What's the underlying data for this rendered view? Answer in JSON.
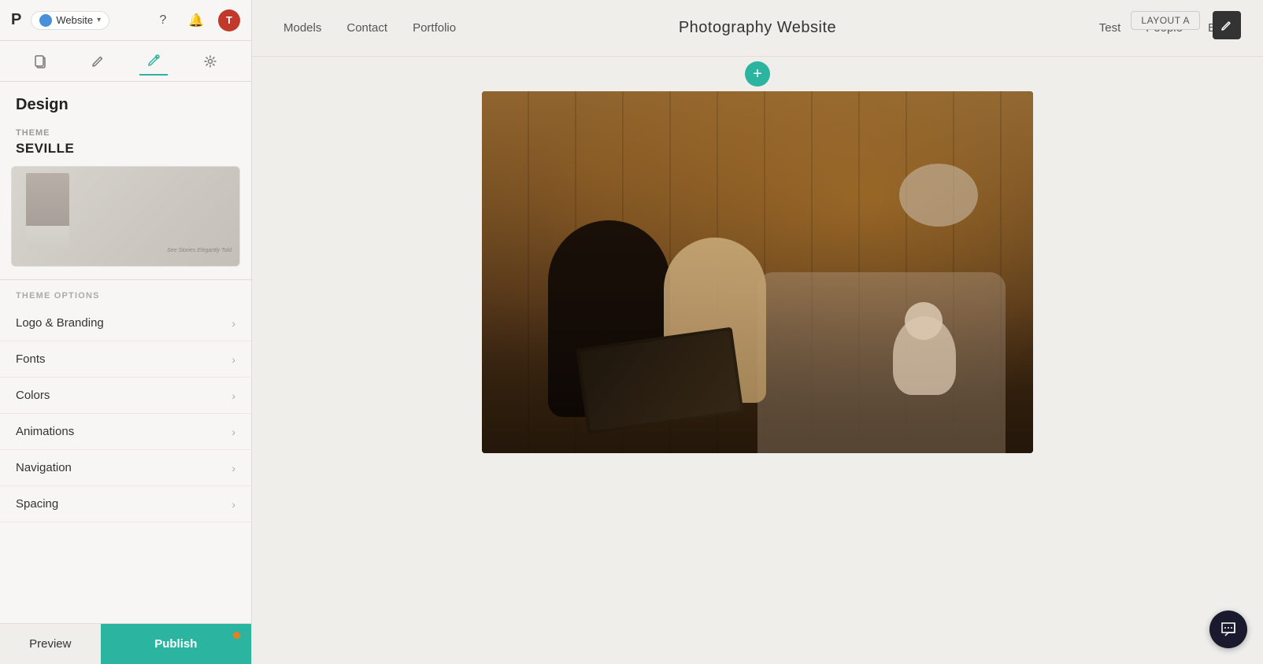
{
  "sidebar": {
    "logo": "P",
    "website_label": "Website",
    "header_icons": {
      "help_icon": "?",
      "bell_icon": "🔔",
      "avatar_label": "T"
    },
    "toolbar": {
      "copy_icon": "⧉",
      "edit_icon": "✏",
      "design_icon": "✏",
      "settings_icon": "⚙"
    },
    "design_heading": "Design",
    "theme": {
      "label": "THEME",
      "name": "SEVILLE"
    },
    "theme_options_label": "THEME OPTIONS",
    "options": [
      {
        "label": "Logo & Branding"
      },
      {
        "label": "Fonts"
      },
      {
        "label": "Colors"
      },
      {
        "label": "Animations"
      },
      {
        "label": "Navigation"
      },
      {
        "label": "Spacing"
      }
    ],
    "footer": {
      "preview_label": "Preview",
      "publish_label": "Publish"
    }
  },
  "main": {
    "nav": {
      "left_links": [
        "Models",
        "Contact",
        "Portfolio"
      ],
      "site_title": "Photography Website",
      "right_links": [
        "Test",
        "People",
        "Blog"
      ]
    },
    "layout_badge": "LAYOUT A",
    "add_section_tooltip": "Add section"
  },
  "chat_icon": "💬"
}
